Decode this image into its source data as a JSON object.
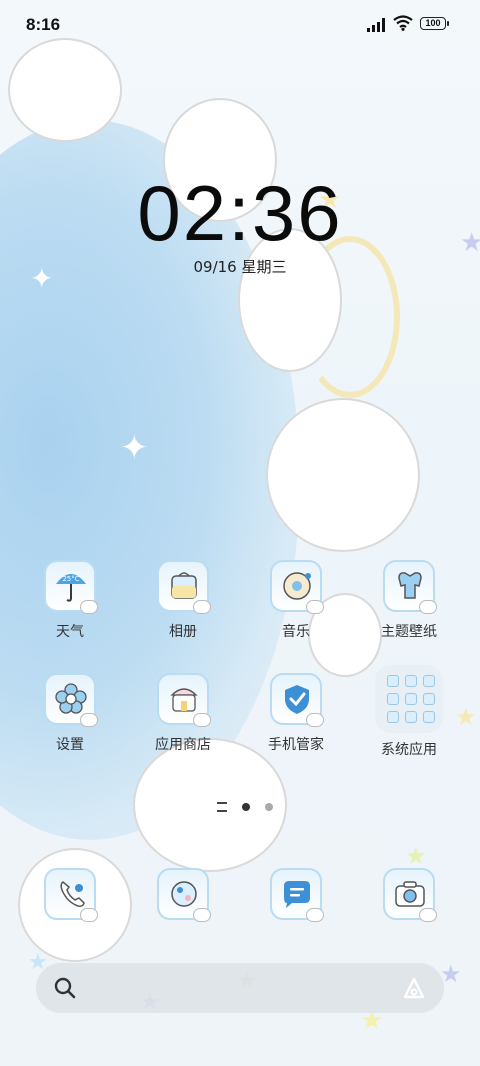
{
  "status_bar": {
    "time": "8:16",
    "battery": "100"
  },
  "lock_clock": {
    "time": "02:36",
    "date": "09/16 星期三"
  },
  "apps": [
    {
      "label": "天气",
      "icon": "weather-umbrella-icon"
    },
    {
      "label": "相册",
      "icon": "gallery-icon"
    },
    {
      "label": "音乐",
      "icon": "music-icon"
    },
    {
      "label": "主题壁纸",
      "icon": "theme-wallpaper-icon"
    },
    {
      "label": "设置",
      "icon": "settings-flower-icon"
    },
    {
      "label": "应用商店",
      "icon": "app-store-icon"
    },
    {
      "label": "手机管家",
      "icon": "security-shield-icon"
    }
  ],
  "folder": {
    "label": "系统应用"
  },
  "weather_icon_text": "25°C",
  "dock": [
    {
      "icon": "phone-icon"
    },
    {
      "icon": "browser-icon"
    },
    {
      "icon": "messages-icon"
    },
    {
      "icon": "camera-icon"
    }
  ],
  "pager": {
    "current": 2,
    "total": 3
  },
  "colors": {
    "tile_border": "#b9dcf3",
    "accent_blue": "#3d8fd6"
  }
}
